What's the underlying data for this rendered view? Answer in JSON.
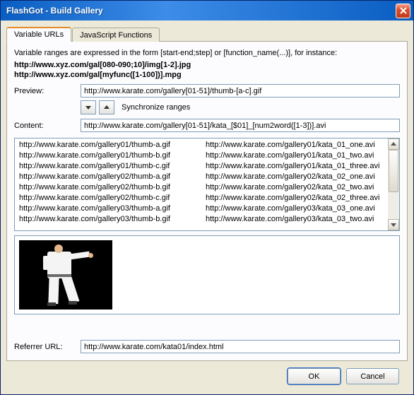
{
  "window": {
    "title": "FlashGot - Build Gallery"
  },
  "tabs": [
    {
      "label": "Variable URLs",
      "active": true
    },
    {
      "label": "JavaScript Functions",
      "active": false
    }
  ],
  "intro": "Variable ranges are expressed in the form [start-end;step] or [function_name(...)], for instance:",
  "examples": [
    "http://www.xyz.com/gal[080-090;10]/img[1-2].jpg",
    "http://www.xyz.com/gal[myfunc([1-100])].mpg"
  ],
  "preview": {
    "label": "Preview:",
    "value": "http://www.karate.com/gallery[01-51]/thumb-[a-c].gif",
    "sync_label": "Synchronize ranges"
  },
  "content": {
    "label": "Content:",
    "value": "http://www.karate.com/gallery[01-51]/kata_[$01]_[num2word([1-3])].avi"
  },
  "list": {
    "left": [
      "http://www.karate.com/gallery01/thumb-a.gif",
      "http://www.karate.com/gallery01/thumb-b.gif",
      "http://www.karate.com/gallery01/thumb-c.gif",
      "http://www.karate.com/gallery02/thumb-a.gif",
      "http://www.karate.com/gallery02/thumb-b.gif",
      "http://www.karate.com/gallery02/thumb-c.gif",
      "http://www.karate.com/gallery03/thumb-a.gif",
      "http://www.karate.com/gallery03/thumb-b.gif"
    ],
    "right": [
      "http://www.karate.com/gallery01/kata_01_one.avi",
      "http://www.karate.com/gallery01/kata_01_two.avi",
      "http://www.karate.com/gallery01/kata_01_three.avi",
      "http://www.karate.com/gallery02/kata_02_one.avi",
      "http://www.karate.com/gallery02/kata_02_two.avi",
      "http://www.karate.com/gallery02/kata_02_three.avi",
      "http://www.karate.com/gallery03/kata_03_one.avi",
      "http://www.karate.com/gallery03/kata_03_two.avi"
    ]
  },
  "referrer": {
    "label": "Referrer URL:",
    "value": "http://www.karate.com/kata01/index.html"
  },
  "buttons": {
    "ok": "OK",
    "cancel": "Cancel"
  }
}
